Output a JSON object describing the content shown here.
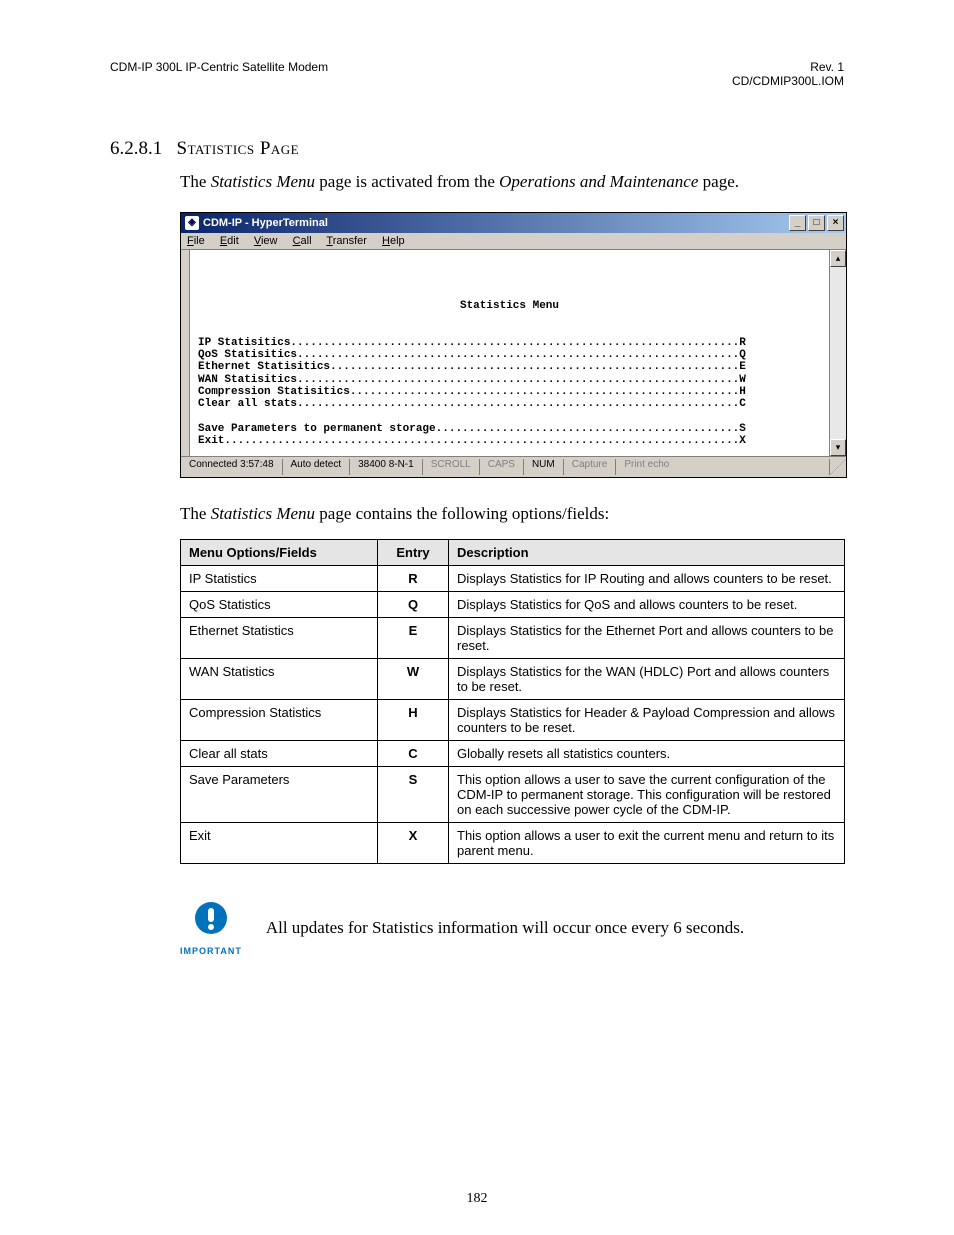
{
  "header": {
    "left": "CDM-IP 300L IP-Centric Satellite Modem",
    "right1": "Rev. 1",
    "right2": "CD/CDMIP300L.IOM"
  },
  "section": {
    "number": "6.2.8.1",
    "title": "Statistics Page"
  },
  "intro_pre": "The ",
  "intro_ital1": "Statistics Menu",
  "intro_mid": " page is activated from the ",
  "intro_ital2": "Operations and Maintenance",
  "intro_post": " page.",
  "hyperterm": {
    "title": "CDM-IP - HyperTerminal",
    "menus": {
      "file": "File",
      "edit": "Edit",
      "view": "View",
      "call": "Call",
      "transfer": "Transfer",
      "help": "Help"
    },
    "term_title": "Statistics Menu",
    "lines": [
      "IP Statisitics....................................................................R",
      "QoS Statisitics...................................................................Q",
      "Ethernet Statisitics..............................................................E",
      "WAN Statisitics...................................................................W",
      "Compression Statisitics...........................................................H",
      "Clear all stats...................................................................C",
      "",
      "Save Parameters to permanent storage..............................................S",
      "Exit..............................................................................X"
    ],
    "status": {
      "connected": "Connected 3:57:48",
      "detect": "Auto detect",
      "port": "38400 8-N-1",
      "scroll": "SCROLL",
      "caps": "CAPS",
      "num": "NUM",
      "capture": "Capture",
      "printecho": "Print echo"
    }
  },
  "between_pre": "The ",
  "between_ital": "Statistics Menu",
  "between_post": " page contains the following options/fields:",
  "table": {
    "headers": {
      "menu": "Menu Options/Fields",
      "entry": "Entry",
      "desc": "Description"
    },
    "rows": [
      {
        "menu": "IP Statistics",
        "entry": "R",
        "desc": "Displays Statistics for IP Routing and allows counters to be reset."
      },
      {
        "menu": "QoS Statistics",
        "entry": "Q",
        "desc": "Displays Statistics for QoS and allows counters to be reset."
      },
      {
        "menu": "Ethernet Statistics",
        "entry": "E",
        "desc": "Displays Statistics for the Ethernet Port and allows counters to be reset."
      },
      {
        "menu": "WAN Statistics",
        "entry": "W",
        "desc": "Displays Statistics for the WAN (HDLC) Port and allows counters to be reset."
      },
      {
        "menu": "Compression Statistics",
        "entry": "H",
        "desc": "Displays Statistics for Header & Payload Compression and allows counters to be reset."
      },
      {
        "menu": "Clear all stats",
        "entry": "C",
        "desc": "Globally resets all statistics counters."
      },
      {
        "menu": "Save Parameters",
        "entry": "S",
        "desc": "This option allows a user to save the current configuration of the CDM-IP to permanent storage. This configuration will be restored on each successive power cycle of the CDM-IP."
      },
      {
        "menu": "Exit",
        "entry": "X",
        "desc": "This option allows a user to exit the current menu and return to its parent menu."
      }
    ]
  },
  "important": {
    "label": "IMPORTANT",
    "text": "All updates for Statistics information will occur once every 6 seconds."
  },
  "pagenum": "182"
}
